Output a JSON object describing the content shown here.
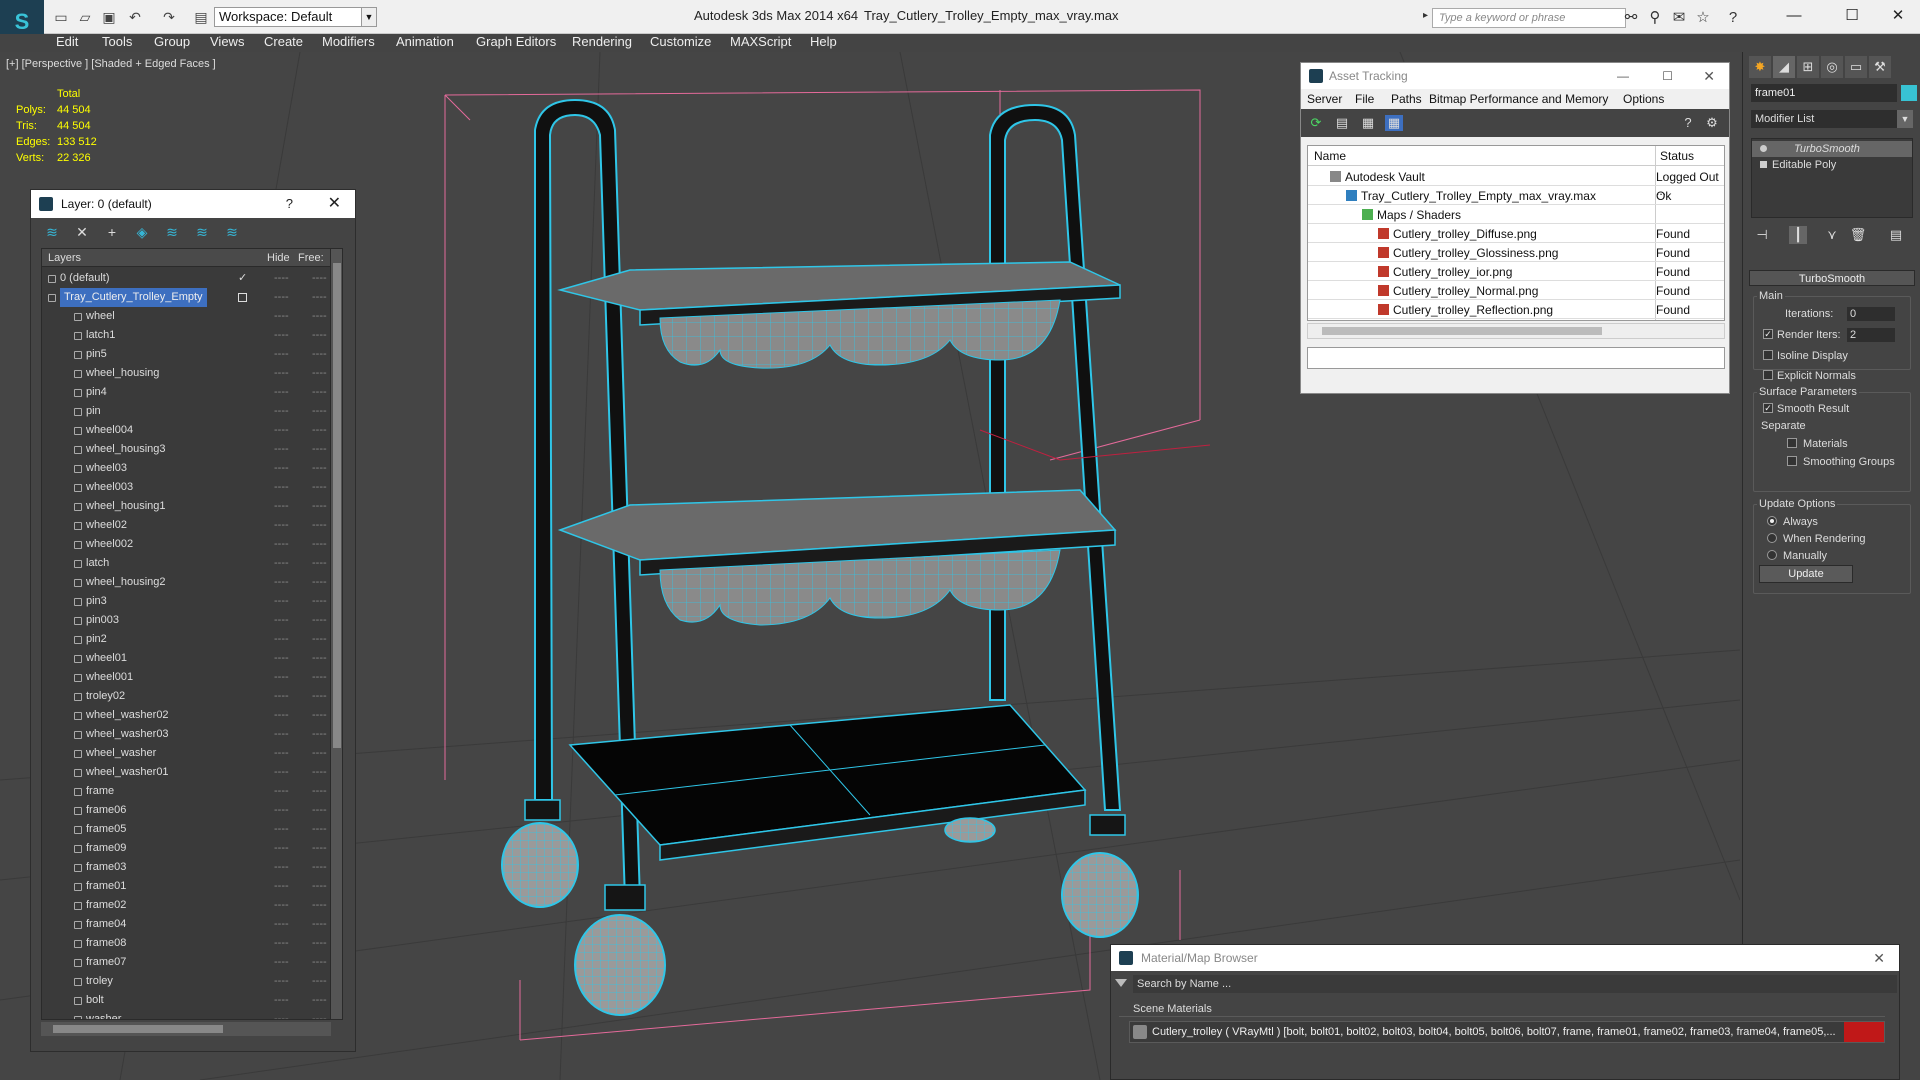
{
  "titlebar": {
    "app_name": "Autodesk 3ds Max  2014 x64",
    "file_name": "Tray_Cutlery_Trolley_Empty_max_vray.max",
    "workspace_label": "Workspace: Default",
    "search_placeholder": "Type a keyword or phrase"
  },
  "menubar": [
    "Edit",
    "Tools",
    "Group",
    "Views",
    "Create",
    "Modifiers",
    "Animation",
    "Graph Editors",
    "Rendering",
    "Customize",
    "MAXScript",
    "Help"
  ],
  "viewport": {
    "label": "[+] [Perspective ] [Shaded + Edged Faces ]",
    "stats": {
      "header": "Total",
      "rows": [
        {
          "label": "Polys:",
          "value": "44 504"
        },
        {
          "label": "Tris:",
          "value": "44 504"
        },
        {
          "label": "Edges:",
          "value": "133 512"
        },
        {
          "label": "Verts:",
          "value": "22 326"
        }
      ]
    }
  },
  "layer_dialog": {
    "title": "Layer: 0 (default)",
    "help": "?",
    "columns": {
      "layers": "Layers",
      "hide": "Hide",
      "freeze": "Free:"
    },
    "layers": [
      {
        "name": "0 (default)",
        "level": 0,
        "check": "✓"
      },
      {
        "name": "Tray_Cutlery_Trolley_Empty",
        "level": 0,
        "selected": true
      },
      {
        "name": "wheel",
        "level": 1
      },
      {
        "name": "latch1",
        "level": 1
      },
      {
        "name": "pin5",
        "level": 1
      },
      {
        "name": "wheel_housing",
        "level": 1
      },
      {
        "name": "pin4",
        "level": 1
      },
      {
        "name": "pin",
        "level": 1
      },
      {
        "name": "wheel004",
        "level": 1
      },
      {
        "name": "wheel_housing3",
        "level": 1
      },
      {
        "name": "wheel03",
        "level": 1
      },
      {
        "name": "wheel003",
        "level": 1
      },
      {
        "name": "wheel_housing1",
        "level": 1
      },
      {
        "name": "wheel02",
        "level": 1
      },
      {
        "name": "wheel002",
        "level": 1
      },
      {
        "name": "latch",
        "level": 1
      },
      {
        "name": "wheel_housing2",
        "level": 1
      },
      {
        "name": "pin3",
        "level": 1
      },
      {
        "name": "pin003",
        "level": 1
      },
      {
        "name": "pin2",
        "level": 1
      },
      {
        "name": "wheel01",
        "level": 1
      },
      {
        "name": "wheel001",
        "level": 1
      },
      {
        "name": "troley02",
        "level": 1
      },
      {
        "name": "wheel_washer02",
        "level": 1
      },
      {
        "name": "wheel_washer03",
        "level": 1
      },
      {
        "name": "wheel_washer",
        "level": 1
      },
      {
        "name": "wheel_washer01",
        "level": 1
      },
      {
        "name": "frame",
        "level": 1
      },
      {
        "name": "frame06",
        "level": 1
      },
      {
        "name": "frame05",
        "level": 1
      },
      {
        "name": "frame09",
        "level": 1
      },
      {
        "name": "frame03",
        "level": 1
      },
      {
        "name": "frame01",
        "level": 1
      },
      {
        "name": "frame02",
        "level": 1
      },
      {
        "name": "frame04",
        "level": 1
      },
      {
        "name": "frame08",
        "level": 1
      },
      {
        "name": "frame07",
        "level": 1
      },
      {
        "name": "troley",
        "level": 1
      },
      {
        "name": "bolt",
        "level": 1
      },
      {
        "name": "washer",
        "level": 1
      }
    ],
    "dash": "----"
  },
  "asset_tracking": {
    "title": "Asset Tracking",
    "menu": [
      "Server",
      "File",
      "Paths",
      "Bitmap Performance and Memory",
      "Options"
    ],
    "columns": {
      "name": "Name",
      "status": "Status"
    },
    "rows": [
      {
        "name": "Autodesk Vault",
        "status": "Logged Out ...",
        "indent": 0,
        "icon": "vault"
      },
      {
        "name": "Tray_Cutlery_Trolley_Empty_max_vray.max",
        "status": "Ok",
        "indent": 1,
        "icon": "max"
      },
      {
        "name": "Maps / Shaders",
        "status": "",
        "indent": 2,
        "icon": "maps"
      },
      {
        "name": "Cutlery_trolley_Diffuse.png",
        "status": "Found",
        "indent": 3,
        "icon": "png"
      },
      {
        "name": "Cutlery_trolley_Glossiness.png",
        "status": "Found",
        "indent": 3,
        "icon": "png"
      },
      {
        "name": "Cutlery_trolley_ior.png",
        "status": "Found",
        "indent": 3,
        "icon": "png"
      },
      {
        "name": "Cutlery_trolley_Normal.png",
        "status": "Found",
        "indent": 3,
        "icon": "png"
      },
      {
        "name": "Cutlery_trolley_Reflection.png",
        "status": "Found",
        "indent": 3,
        "icon": "png"
      }
    ]
  },
  "command_panel": {
    "object_name": "frame01",
    "object_color": "#38c3d3",
    "modifier_list": "Modifier List",
    "stack": [
      {
        "name": "TurboSmooth",
        "selected": true
      },
      {
        "name": "Editable Poly",
        "selected": false
      }
    ],
    "rollout_title": "TurboSmooth",
    "main_label": "Main",
    "iterations_label": "Iterations:",
    "iterations_value": "0",
    "render_iters_label": "Render Iters:",
    "render_iters_value": "2",
    "render_iters_checked": "✓",
    "isoline_label": "Isoline Display",
    "explicit_label": "Explicit Normals",
    "surface_label": "Surface Parameters",
    "smooth_label": "Smooth Result",
    "smooth_checked": "✓",
    "separate_label": "Separate",
    "materials_label": "Materials",
    "smoothing_groups_label": "Smoothing Groups",
    "update_options_label": "Update Options",
    "always_label": "Always",
    "when_rendering_label": "When Rendering",
    "manually_label": "Manually",
    "update_button": "Update"
  },
  "material_browser": {
    "title": "Material/Map Browser",
    "search_placeholder": "Search by Name ...",
    "group": "Scene Materials",
    "material_entry": "Cutlery_trolley  ( VRayMtl )  [bolt, bolt01, bolt02, bolt03, bolt04, bolt05, bolt06, bolt07, frame, frame01, frame02, frame03, frame04, frame05,..."
  },
  "colors": {
    "wire": "#2fc6e8",
    "bbox": "#e46a9a",
    "accent": "#3d6fc0"
  }
}
